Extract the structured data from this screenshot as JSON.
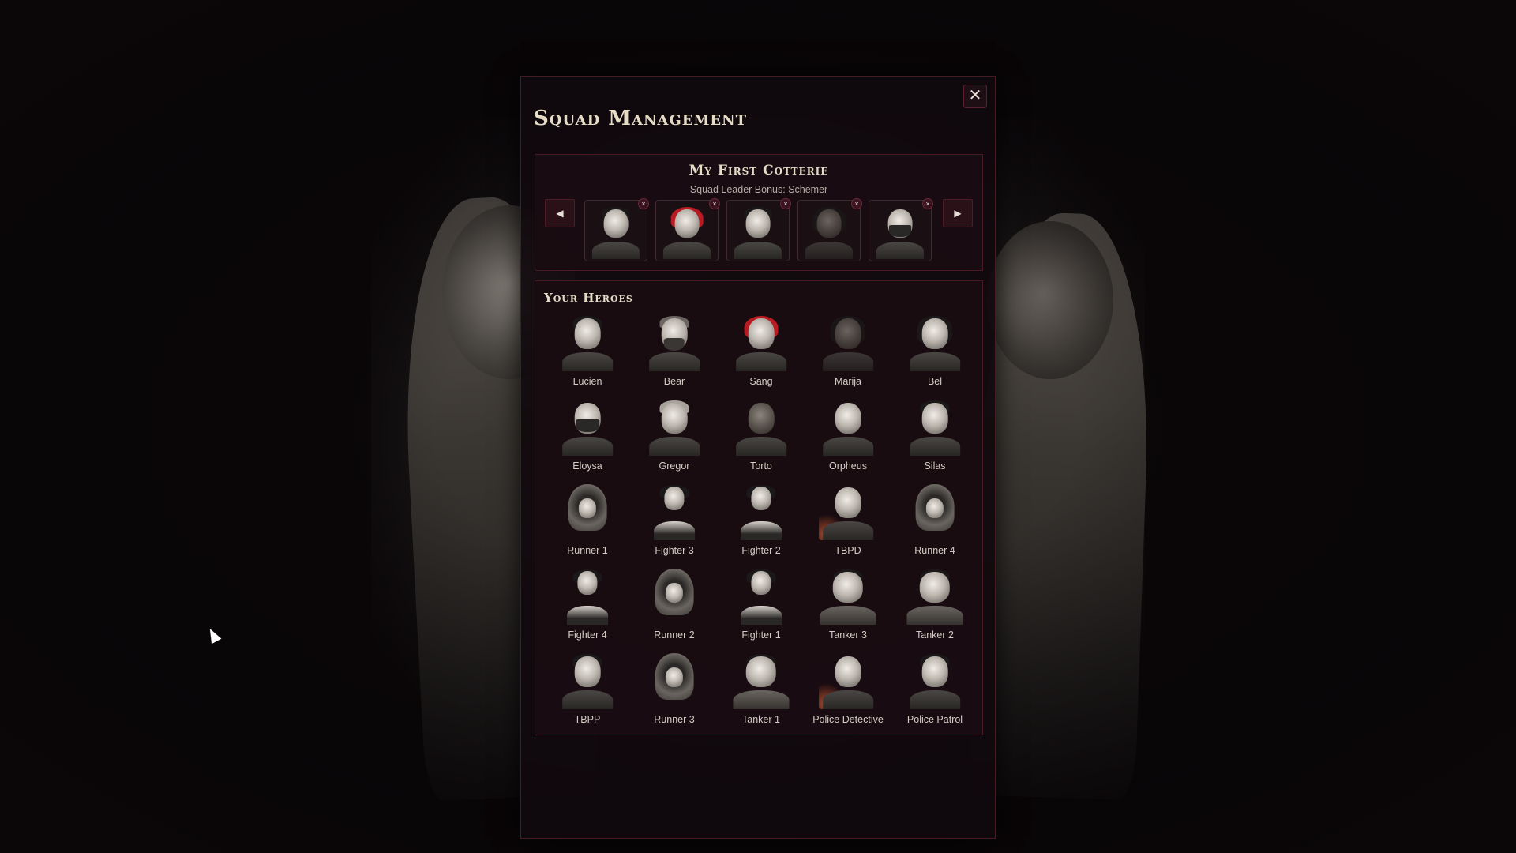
{
  "modal": {
    "title": "Squad Management",
    "close_label": "✕"
  },
  "squad": {
    "name": "My First Cotterie",
    "bonus": "Squad Leader Bonus: Schemer",
    "prev_label": "◀",
    "next_label": "▶",
    "remove_label": "×",
    "members": [
      {
        "hero": "Lucien",
        "portrait": "suit-man-icon"
      },
      {
        "hero": "Sang",
        "portrait": "red-hair-woman-icon"
      },
      {
        "hero": "Silas",
        "portrait": "dark-hair-man-icon"
      },
      {
        "hero": "Marija",
        "portrait": "braided-hair-woman-icon"
      },
      {
        "hero": "Eloysa",
        "portrait": "masked-woman-icon"
      }
    ]
  },
  "heroes": {
    "title": "Your Heroes",
    "list": [
      {
        "name": "Lucien",
        "portrait": "suit-man-icon"
      },
      {
        "name": "Bear",
        "portrait": "bearded-man-icon"
      },
      {
        "name": "Sang",
        "portrait": "red-hair-woman-icon"
      },
      {
        "name": "Marija",
        "portrait": "braided-hair-woman-icon"
      },
      {
        "name": "Bel",
        "portrait": "long-hair-woman-icon"
      },
      {
        "name": "Eloysa",
        "portrait": "masked-woman-icon"
      },
      {
        "name": "Gregor",
        "portrait": "old-man-glasses-icon"
      },
      {
        "name": "Torto",
        "portrait": "bald-man-icon"
      },
      {
        "name": "Orpheus",
        "portrait": "blindfolded-man-icon"
      },
      {
        "name": "Silas",
        "portrait": "dark-hair-man-icon"
      },
      {
        "name": "Runner 1",
        "portrait": "hooded-runner-icon"
      },
      {
        "name": "Fighter 3",
        "portrait": "fighter-icon"
      },
      {
        "name": "Fighter 2",
        "portrait": "fighter-icon"
      },
      {
        "name": "TBPD",
        "portrait": "bald-detective-icon"
      },
      {
        "name": "Runner 4",
        "portrait": "hooded-runner-icon"
      },
      {
        "name": "Fighter 4",
        "portrait": "fighter-icon"
      },
      {
        "name": "Runner 2",
        "portrait": "hooded-runner-icon"
      },
      {
        "name": "Fighter 1",
        "portrait": "fighter-icon"
      },
      {
        "name": "Tanker 3",
        "portrait": "heavy-man-icon"
      },
      {
        "name": "Tanker 2",
        "portrait": "heavy-man-icon"
      },
      {
        "name": "TBPP",
        "portrait": "dark-hair-man-icon"
      },
      {
        "name": "Runner 3",
        "portrait": "hooded-runner-icon"
      },
      {
        "name": "Tanker 1",
        "portrait": "heavy-man-icon"
      },
      {
        "name": "Police Detective",
        "portrait": "bald-detective-icon"
      },
      {
        "name": "Police Patrol",
        "portrait": "dark-hair-man-icon"
      }
    ]
  }
}
